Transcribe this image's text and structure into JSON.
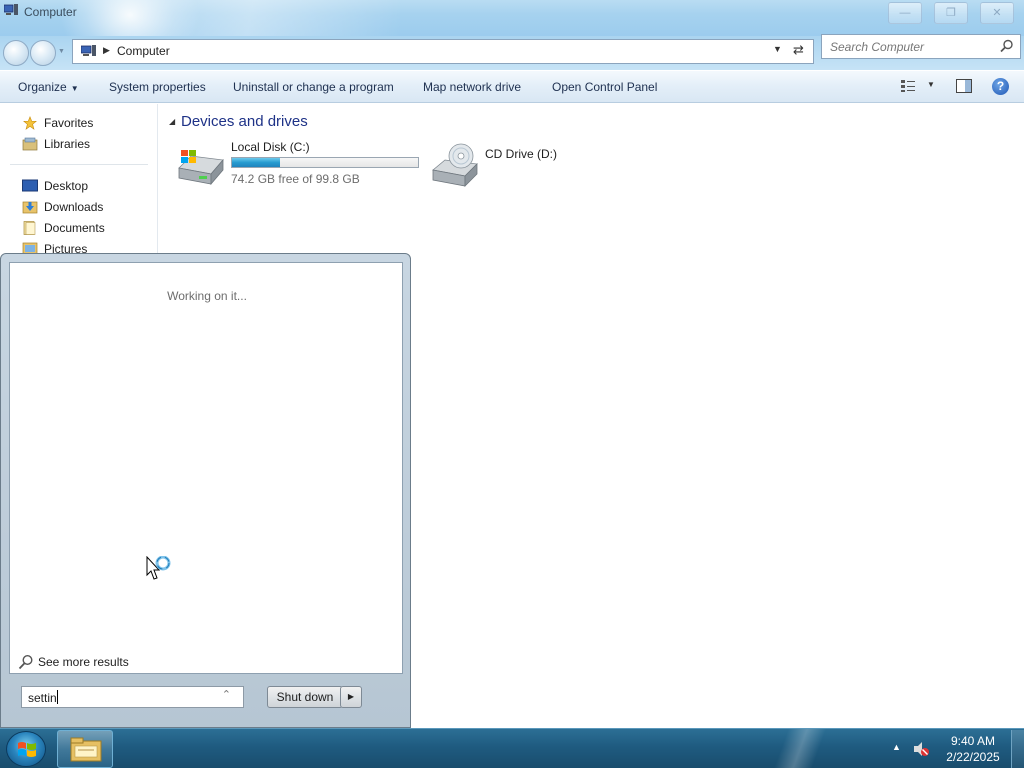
{
  "window": {
    "title": "Computer",
    "address": "Computer",
    "search_placeholder": "Search Computer"
  },
  "toolbar": {
    "organize": "Organize",
    "system_properties": "System properties",
    "uninstall": "Uninstall or change a program",
    "map_network": "Map network drive",
    "control_panel": "Open Control Panel"
  },
  "nav": {
    "favorites": "Favorites",
    "libraries": "Libraries",
    "desktop": "Desktop",
    "downloads": "Downloads",
    "documents": "Documents",
    "pictures": "Pictures"
  },
  "content": {
    "group_title": "Devices and drives",
    "drives": [
      {
        "name": "Local Disk (C:)",
        "free": "74.2 GB free of 99.8 GB",
        "used_fraction": 0.26
      },
      {
        "name": "CD Drive (D:)"
      }
    ]
  },
  "start_menu": {
    "status": "Working on it...",
    "see_more": "See more results",
    "search_value": "settin",
    "shutdown_label": "Shut down"
  },
  "taskbar": {
    "time": "9:40 AM",
    "date": "2/22/2025"
  }
}
